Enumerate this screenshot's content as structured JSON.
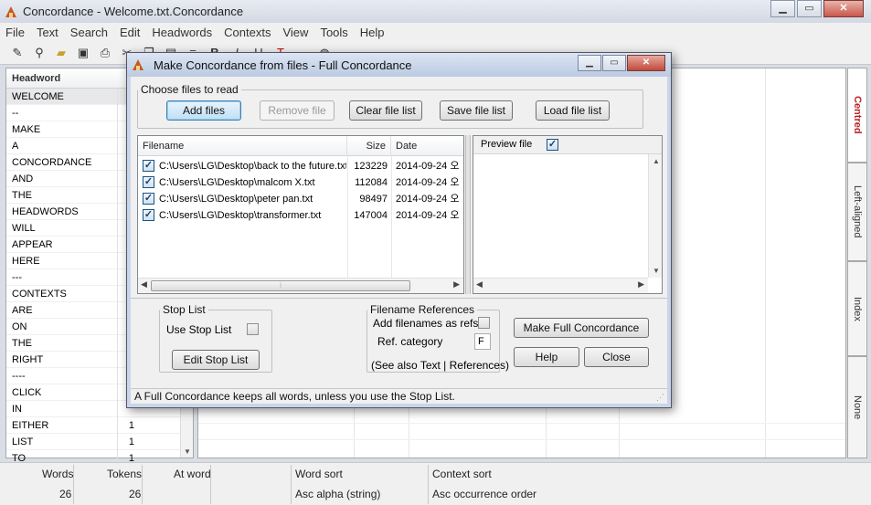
{
  "app": {
    "title": "Concordance - Welcome.txt.Concordance",
    "window_controls": [
      "minimize",
      "maximize",
      "close"
    ]
  },
  "menu": [
    "File",
    "Text",
    "Search",
    "Edit",
    "Headwords",
    "Contexts",
    "View",
    "Tools",
    "Help"
  ],
  "toolbar": {
    "icons": [
      "pencil-icon",
      "binoculars-icon",
      "open-folder-icon",
      "save-icon",
      "print-icon",
      "cut-icon",
      "copy-icon",
      "paste-icon",
      "center-align-icon",
      "bold-icon",
      "italic-icon",
      "underline-icon",
      "text-color-icon",
      "highlight-icon",
      "globe-icon"
    ]
  },
  "headword_pane": {
    "header": "Headword",
    "rows": [
      {
        "word": "WELCOME",
        "count": ""
      },
      {
        "word": "--",
        "count": ""
      },
      {
        "word": "MAKE",
        "count": ""
      },
      {
        "word": "A",
        "count": ""
      },
      {
        "word": "CONCORDANCE",
        "count": ""
      },
      {
        "word": "AND",
        "count": ""
      },
      {
        "word": "THE",
        "count": ""
      },
      {
        "word": "HEADWORDS",
        "count": ""
      },
      {
        "word": "WILL",
        "count": ""
      },
      {
        "word": "APPEAR",
        "count": ""
      },
      {
        "word": "HERE",
        "count": ""
      },
      {
        "word": "---",
        "count": ""
      },
      {
        "word": "CONTEXTS",
        "count": ""
      },
      {
        "word": "ARE",
        "count": ""
      },
      {
        "word": "ON",
        "count": ""
      },
      {
        "word": "THE",
        "count": ""
      },
      {
        "word": "RIGHT",
        "count": ""
      },
      {
        "word": "----",
        "count": ""
      },
      {
        "word": "CLICK",
        "count": ""
      },
      {
        "word": "IN",
        "count": ""
      },
      {
        "word": "EITHER",
        "count": "1"
      },
      {
        "word": "LIST",
        "count": "1"
      },
      {
        "word": "TO",
        "count": "1"
      }
    ]
  },
  "right_tabs": [
    "Centred",
    "Left-aligned",
    "Index",
    "None"
  ],
  "status": {
    "headers": {
      "words": "Words",
      "tokens": "Tokens",
      "at_word": "At word",
      "word_sort": "Word sort",
      "context_sort": "Context sort"
    },
    "values": {
      "words": "26",
      "tokens": "26",
      "at_word": "",
      "word_sort": "Asc alpha (string)",
      "context_sort": "Asc occurrence order"
    }
  },
  "dialog": {
    "title": "Make Concordance from files - Full Concordance",
    "choose_group": "Choose files to read",
    "buttons": {
      "add": "Add files",
      "remove": "Remove file",
      "clear": "Clear file list",
      "save": "Save file list",
      "load": "Load file list",
      "stop_list": "Edit Stop List",
      "make": "Make Full Concordance",
      "help": "Help",
      "close": "Close"
    },
    "file_columns": {
      "filename": "Filename",
      "size": "Size",
      "date": "Date"
    },
    "files": [
      {
        "checked": true,
        "name": "C:\\Users\\LG\\Desktop\\back to the future.txt",
        "size": "123229",
        "date": "2014-09-24 오"
      },
      {
        "checked": true,
        "name": "C:\\Users\\LG\\Desktop\\malcom X.txt",
        "size": "112084",
        "date": "2014-09-24 오"
      },
      {
        "checked": true,
        "name": "C:\\Users\\LG\\Desktop\\peter pan.txt",
        "size": "98497",
        "date": "2014-09-24 오"
      },
      {
        "checked": true,
        "name": "C:\\Users\\LG\\Desktop\\transformer.txt",
        "size": "147004",
        "date": "2014-09-24 오"
      }
    ],
    "preview": {
      "label": "Preview file",
      "checked": true
    },
    "stop_list": {
      "group": "Stop List",
      "use_label": "Use Stop List",
      "checked": false
    },
    "filename_refs": {
      "group": "Filename References",
      "add_label": "Add filenames as refs",
      "add_checked": false,
      "category_label": "Ref. category",
      "category_value": "F",
      "see_also": "(See also Text | References)"
    },
    "status_text": "A Full Concordance keeps all words, unless you use the Stop List."
  }
}
